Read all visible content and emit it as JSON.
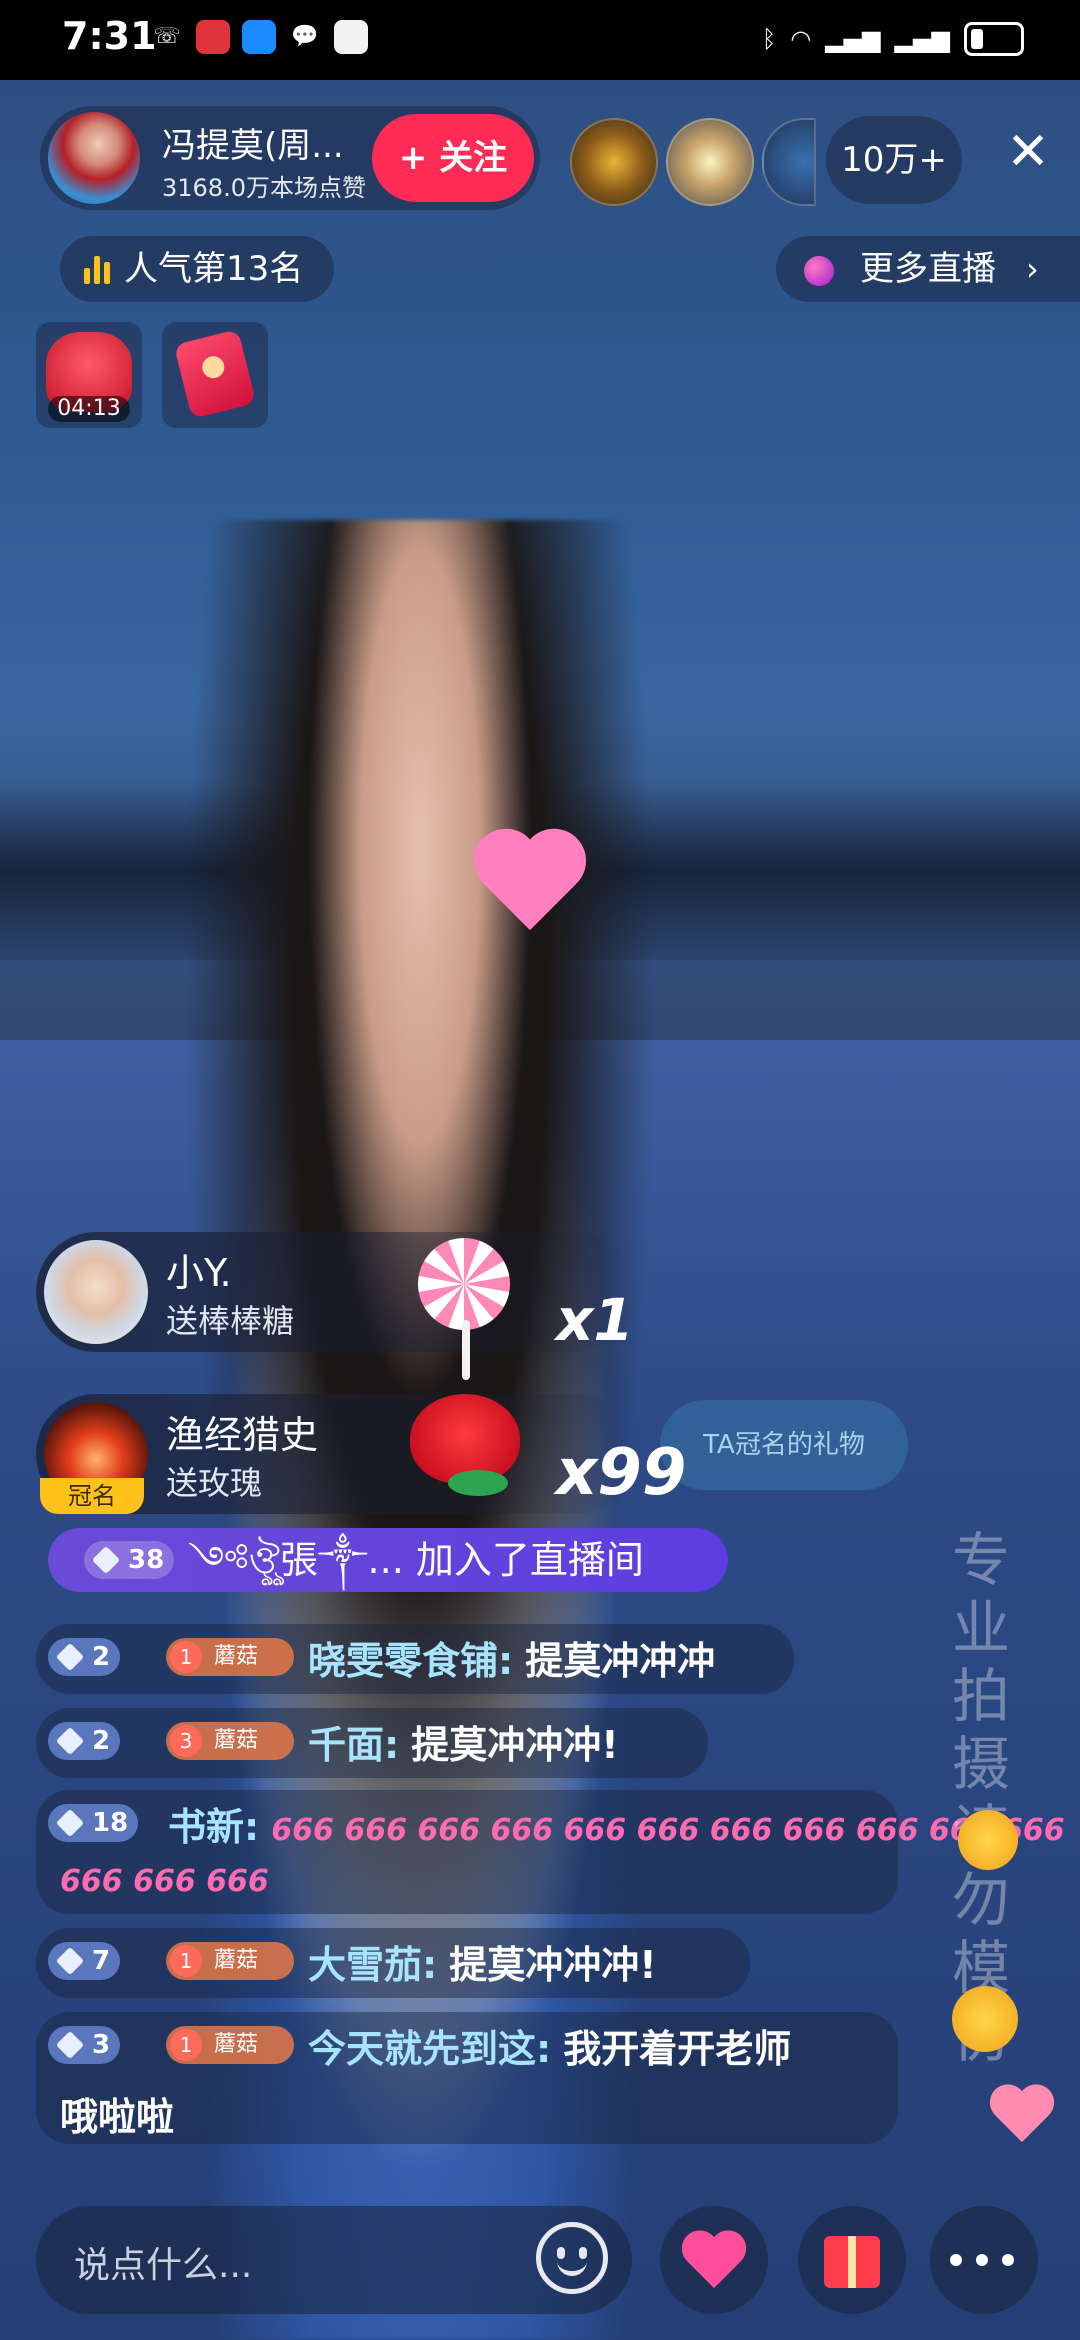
{
  "status_bar": {
    "time": "7:31",
    "icons": [
      "missed-call-icon",
      "app-icon",
      "app-icon",
      "chat-icon",
      "app-icon"
    ],
    "right_icons": [
      "bluetooth-icon",
      "wifi-icon",
      "signal-5g-icon",
      "signal-4g-icon",
      "battery-icon"
    ]
  },
  "anchor": {
    "name": "冯提莫(周...",
    "likes": "3168.0万本场点赞",
    "follow_label": "+ 关注"
  },
  "viewers": {
    "count": "10万+"
  },
  "rank": {
    "label": "人气第13名"
  },
  "more_live": {
    "label": "更多直播"
  },
  "gifts_top": {
    "timer": "04:13"
  },
  "gift_notifications": [
    {
      "user": "小Y.",
      "action": "送棒棒糖",
      "multiplier": "x1"
    },
    {
      "user": "渔经猎史",
      "action": "送玫瑰",
      "multiplier": "x99",
      "badge": "冠名",
      "tag": "TA冠名的礼物"
    }
  ],
  "join_banner": {
    "level": "38",
    "text": "༺ঔৣ張༒... 加入了直播间"
  },
  "chat": [
    {
      "level": "2",
      "fan_level": "1",
      "fan_name": "蘑菇",
      "user": "晓雯零食铺:",
      "message": "提莫冲冲冲"
    },
    {
      "level": "2",
      "fan_level": "3",
      "fan_name": "蘑菇",
      "user": "千面:",
      "message": "提莫冲冲冲!"
    },
    {
      "level": "18",
      "user": "书新:",
      "message_line1": "666 666 666 666 666 666 666 666 666 666 666",
      "message_line2": "666 666 666"
    },
    {
      "level": "7",
      "fan_level": "1",
      "fan_name": "蘑菇",
      "user": "大雪茄:",
      "message": "提莫冲冲冲!"
    },
    {
      "level": "3",
      "fan_level": "1",
      "fan_name": "蘑菇",
      "user": "今天就先到这:",
      "message": "我开着开老师",
      "message_line2": "哦啦啦"
    }
  ],
  "watermark": {
    "chars": [
      "专",
      "业",
      "拍",
      "摄",
      "请",
      "勿",
      "模",
      "仿"
    ]
  },
  "bottom_bar": {
    "input_placeholder": "说点什么..."
  }
}
